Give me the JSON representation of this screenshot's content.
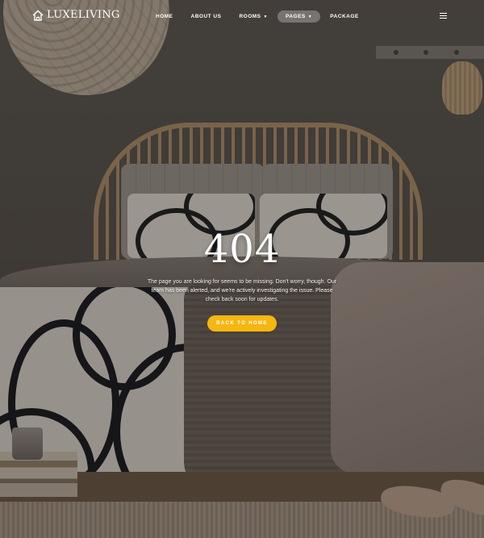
{
  "brand": {
    "name": "LUXELIVING",
    "icon": "house-icon"
  },
  "nav": {
    "items": [
      {
        "label": "HOME",
        "has_dropdown": false,
        "active": false
      },
      {
        "label": "ABOUT US",
        "has_dropdown": false,
        "active": false
      },
      {
        "label": "ROOMS",
        "has_dropdown": true,
        "active": false
      },
      {
        "label": "PAGES",
        "has_dropdown": true,
        "active": true
      },
      {
        "label": "PACKAGE",
        "has_dropdown": false,
        "active": false
      }
    ],
    "menu_icon": "hamburger-icon"
  },
  "error": {
    "code": "404",
    "message": "The page you are looking for seems to be missing. Don't worry, though. Our team has been alerted, and we're actively investigating the issue. Please check back soon for updates.",
    "button_label": "BACK TO HOME"
  },
  "colors": {
    "accent": "#f5b710",
    "text": "#ffffff"
  }
}
